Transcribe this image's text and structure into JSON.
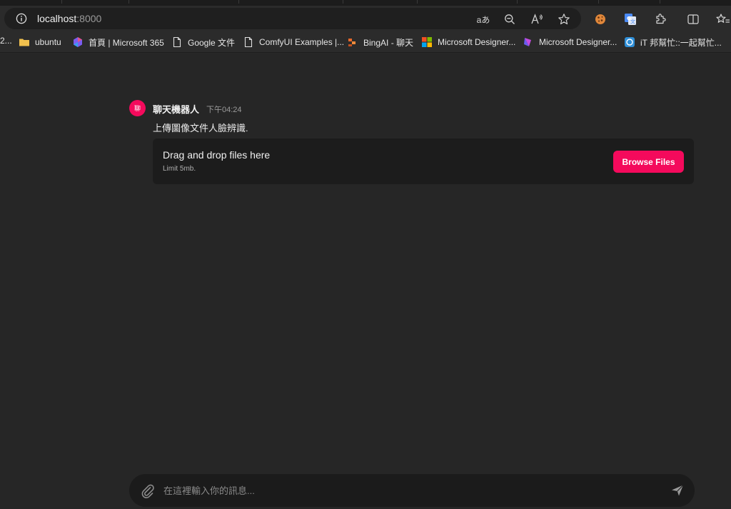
{
  "browser": {
    "url_host": "localhost",
    "url_port": ":8000",
    "bookmarks_edge": "2...",
    "bookmarks": [
      {
        "label": "ubuntu"
      },
      {
        "label": "首頁 | Microsoft 365"
      },
      {
        "label": "Google 文件"
      },
      {
        "label": "ComfyUI Examples |..."
      },
      {
        "label": "BingAI - 聊天"
      },
      {
        "label": "Microsoft Designer..."
      },
      {
        "label": "Microsoft Designer..."
      },
      {
        "label": "iT 邦幫忙::一起幫忙..."
      }
    ],
    "read_aloud_label": "aあ"
  },
  "chat": {
    "avatar_text": "聊",
    "author": "聊天機器人",
    "timestamp": "下午04:24",
    "message": "上傳圖像文件人臉辨識.",
    "dropzone": {
      "title": "Drag and drop files here",
      "limit": "Limit 5mb.",
      "browse_label": "Browse Files"
    },
    "composer": {
      "placeholder": "在這裡輸入你的訊息...",
      "value": ""
    }
  },
  "colors": {
    "accent": "#f40a5c",
    "page_bg": "#262626",
    "card_bg": "#1c1c1c"
  }
}
